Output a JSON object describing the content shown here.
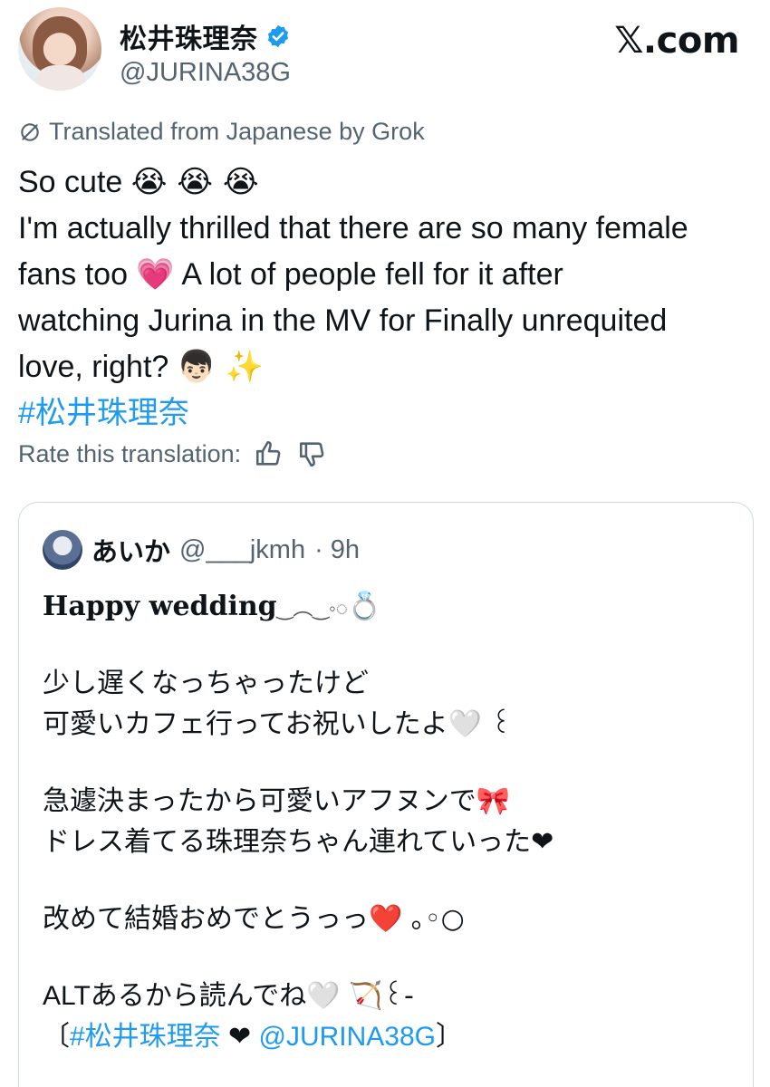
{
  "header": {
    "display_name": "松井珠理奈",
    "handle": "@JURINA38G",
    "site": "𝕏.com"
  },
  "translation": {
    "note": "Translated from Japanese by Grok",
    "rate_label": "Rate this translation:"
  },
  "tweet": {
    "line1_text": "So cute ",
    "line1_emoji": "😭 😭 😭",
    "line2": "I'm actually thrilled that there are so many female",
    "line3_a": "fans too ",
    "line3_emoji": "💗",
    "line3_b": "  A lot of people fell for it after",
    "line4": "watching Jurina in the MV for Finally unrequited",
    "line5_a": "love, right? ",
    "line5_emoji": "👦🏻 ✨",
    "hashtag": "#松井珠理奈"
  },
  "quote": {
    "name": "あいか",
    "handle": "@___jkmh",
    "time": "· 9h",
    "title": "Happy wedding",
    "title_deco": "‿︵‿◦◌",
    "ring": "💍",
    "l1": "少し遅くなっちゃったけど",
    "l2": "可愛いカフェ行ってお祝いしたよ",
    "l2_deco": "🤍 ꒰",
    "l3": "急遽決まったから可愛いアフヌンで",
    "l3_deco": "🎀",
    "l4": "ドレス着てる珠理奈ちゃん連れていった",
    "l4_deco": "❤",
    "l5": "改めて結婚おめでとうっっ",
    "l5_deco": "❤️ ｡◦○",
    "l6": "ALTあるから読んでね",
    "l6_deco": "🤍 🏹꒰-",
    "l7_open": "〔",
    "l7_tag": "#松井珠理奈",
    "l7_heart": "❤",
    "l7_mention": "@JURINA38G",
    "l7_close": "〕"
  },
  "colors": {
    "link": "#1d9bf0",
    "secondary": "#536471",
    "verified": "#1d9bf0",
    "border": "#cfd9de"
  },
  "icons": [
    "verified-badge-icon",
    "grok-translate-icon",
    "thumbs-up-icon",
    "thumbs-down-icon"
  ]
}
